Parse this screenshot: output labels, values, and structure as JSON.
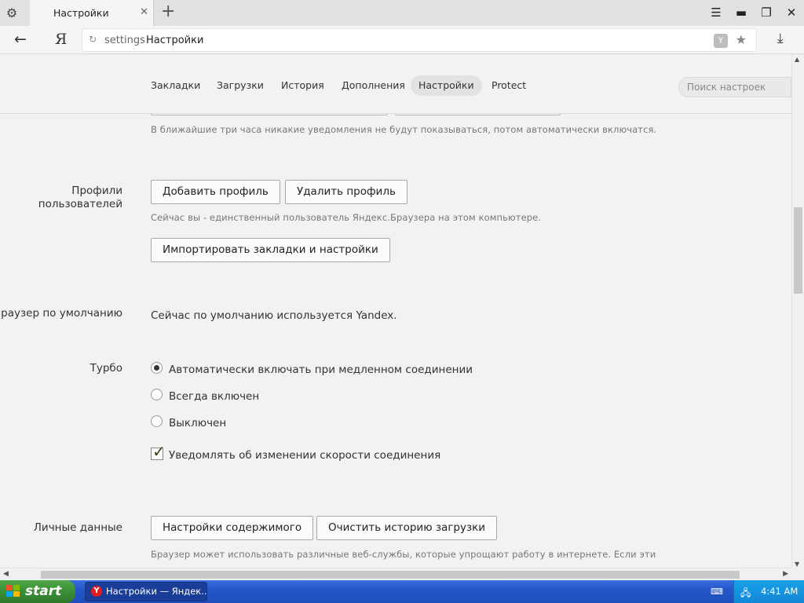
{
  "browser": {
    "tab_title": "Настройки",
    "tab_close": "✕",
    "new_tab": "+",
    "address_proto": "settings",
    "address_page": "Настройки",
    "ya_logo": "Я"
  },
  "nav": {
    "items": [
      "Закладки",
      "Загрузки",
      "История",
      "Дополнения",
      "Настройки",
      "Protect"
    ],
    "active": "Настройки",
    "search_placeholder": "Поиск настроек"
  },
  "notifications": {
    "hint": "В ближайшие три часа никакие уведомления не будут показываться, потом автоматически включатся."
  },
  "profiles": {
    "label_line1": "Профили",
    "label_line2": "пользователей",
    "add_button": "Добавить профиль",
    "delete_button": "Удалить профиль",
    "hint": "Сейчас вы - единственный пользователь Яндекс.Браузера на этом компьютере.",
    "import_button": "Импортировать закладки и настройки"
  },
  "default_browser": {
    "label": "Браузер по умолчанию",
    "text": "Сейчас по умолчанию используется Yandex."
  },
  "turbo": {
    "label": "Турбо",
    "options": [
      {
        "label": "Автоматически включать при медленном соединении",
        "selected": true
      },
      {
        "label": "Всегда включен",
        "selected": false
      },
      {
        "label": "Выключен",
        "selected": false
      }
    ],
    "notify_checkbox": {
      "label": "Уведомлять об изменении скорости соединения",
      "checked": true
    }
  },
  "personal": {
    "label": "Личные данные",
    "content_settings_button": "Настройки содержимого",
    "clear_history_button": "Очистить историю загрузки",
    "hint": "Браузер может использовать различные веб-службы, которые упрощают работу в интернете. Если эти"
  },
  "taskbar": {
    "start": "start",
    "task_label": "Настройки — Яндек...",
    "time": "4:41 AM"
  },
  "icons": {
    "settings": "gear-icon",
    "back": "arrow-left-icon",
    "reload": "reload-icon",
    "bookmark": "star-icon",
    "downloads": "download-icon",
    "yandex_badge": "yandex-icon"
  }
}
